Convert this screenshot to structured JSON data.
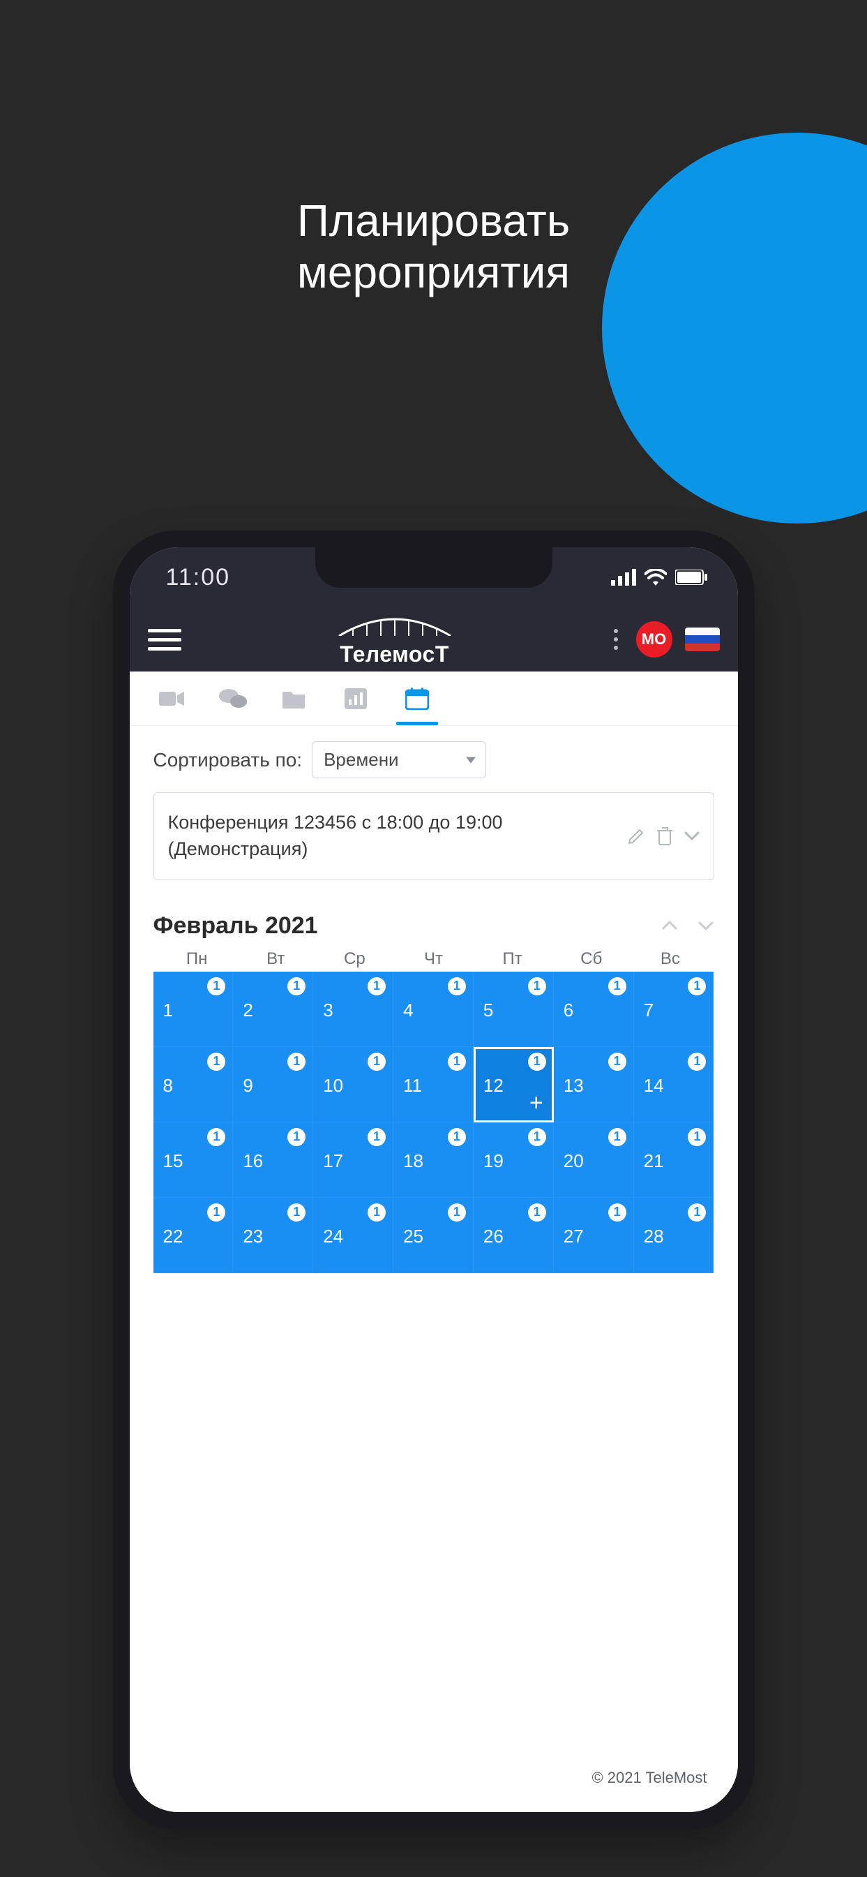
{
  "hero": {
    "line1": "Планировать",
    "line2": "мероприятия"
  },
  "status": {
    "time": "11:00"
  },
  "appbar": {
    "brand": "ТелемосТ",
    "avatar": "МО"
  },
  "tabs": {
    "video": "video-icon",
    "chat": "chat-icon",
    "folder": "folder-icon",
    "stats": "stats-icon",
    "calendar": "calendar-icon",
    "active": "calendar"
  },
  "sort": {
    "label": "Сортировать по:",
    "value": "Времени"
  },
  "event": {
    "title": "Конференция 123456 с 18:00 до 19:00 (Демонстрация)"
  },
  "calendar": {
    "month_title": "Февраль 2021",
    "dow": [
      "Пн",
      "Вт",
      "Ср",
      "Чт",
      "Пт",
      "Сб",
      "Вс"
    ],
    "days": [
      {
        "n": 1,
        "b": 1
      },
      {
        "n": 2,
        "b": 1
      },
      {
        "n": 3,
        "b": 1
      },
      {
        "n": 4,
        "b": 1
      },
      {
        "n": 5,
        "b": 1
      },
      {
        "n": 6,
        "b": 1
      },
      {
        "n": 7,
        "b": 1
      },
      {
        "n": 8,
        "b": 1
      },
      {
        "n": 9,
        "b": 1
      },
      {
        "n": 10,
        "b": 1
      },
      {
        "n": 11,
        "b": 1
      },
      {
        "n": 12,
        "b": 1,
        "selected": true
      },
      {
        "n": 13,
        "b": 1
      },
      {
        "n": 14,
        "b": 1
      },
      {
        "n": 15,
        "b": 1
      },
      {
        "n": 16,
        "b": 1
      },
      {
        "n": 17,
        "b": 1
      },
      {
        "n": 18,
        "b": 1
      },
      {
        "n": 19,
        "b": 1
      },
      {
        "n": 20,
        "b": 1
      },
      {
        "n": 21,
        "b": 1
      },
      {
        "n": 22,
        "b": 1
      },
      {
        "n": 23,
        "b": 1
      },
      {
        "n": 24,
        "b": 1
      },
      {
        "n": 25,
        "b": 1
      },
      {
        "n": 26,
        "b": 1
      },
      {
        "n": 27,
        "b": 1
      },
      {
        "n": 28,
        "b": 1
      }
    ]
  },
  "footer": {
    "copyright": "© 2021 TeleMost"
  }
}
